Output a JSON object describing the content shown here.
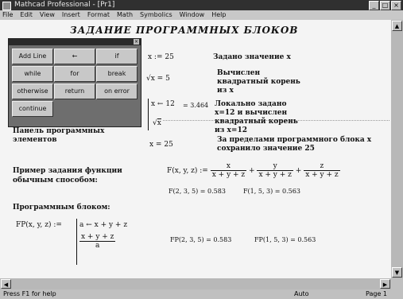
{
  "window": {
    "title": "Mathcad Professional - [Pr1]"
  },
  "menu": [
    "File",
    "Edit",
    "View",
    "Insert",
    "Format",
    "Math",
    "Symbolics",
    "Window",
    "Help"
  ],
  "heading": "ЗАДАНИЕ ПРОГРАММНЫХ БЛОКОВ",
  "palette": {
    "buttons": [
      "Add Line",
      "←",
      "if",
      "while",
      "for",
      "break",
      "otherwise",
      "return",
      "on error",
      "continue"
    ],
    "caption": "Панель программных элементов"
  },
  "math": {
    "assign": "x := 25",
    "sqrt_left": "x = 5",
    "local_assign": "x ← 12",
    "local_sqrt_arg": "x",
    "local_result": "= 3.464",
    "x_after": "x = 25"
  },
  "notes": {
    "n1": "Задано значение x",
    "n2": "Вычислен квадратный корень из x",
    "n3": "Локально задано x=12 и вычислен квадратный корень из x=12",
    "n4": "За пределами программного блока x сохранило значение 25"
  },
  "func": {
    "label": "Пример задания функции обычным способом:",
    "lhs": "F(x, y, z) :=",
    "t1_num": "x",
    "t1_den": "x + y + z",
    "t2_num": "y",
    "t2_den": "x + y + z",
    "t3_num": "z",
    "t3_den": "x + y + z",
    "eval1": "F(2, 3, 5) = 0.583",
    "eval2": "F(1, 5, 3) = 0.563"
  },
  "prog": {
    "label": "Программным блоком:",
    "lhs": "FP(x, y, z) :=",
    "line1": "a ← x + y + z",
    "line2_num": "x + y + z",
    "line2_den": "a",
    "eval1": "FP(2, 3, 5) = 0.583",
    "eval2": "FP(1, 5, 3) = 0.563"
  },
  "status": {
    "hint": "Press F1 for help",
    "mode": "Auto",
    "page": "Page 1"
  }
}
